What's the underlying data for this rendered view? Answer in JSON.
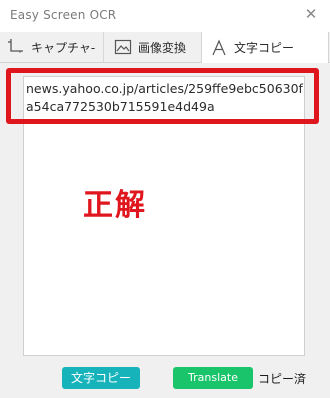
{
  "window": {
    "title": "Easy Screen OCR",
    "close_symbol": "✕"
  },
  "tabs": [
    {
      "label": "キャプチャ-",
      "icon": "crop-icon"
    },
    {
      "label": "画像変換",
      "icon": "image-icon"
    },
    {
      "label": "文字コピー",
      "icon": "text-a-icon"
    }
  ],
  "result": {
    "text": "news.yahoo.co.jp/articles/259ffe9ebc50630fa54ca772530b715591e4d49a"
  },
  "annotation": {
    "label": "正解",
    "color": "#e0161e"
  },
  "footer": {
    "copy_button": "文字コピー",
    "translate_button": "Translate",
    "status": "コピー済"
  },
  "colors": {
    "copy_button": "#16b3bb",
    "translate_button": "#19c46a",
    "annotation": "#e0161e"
  }
}
